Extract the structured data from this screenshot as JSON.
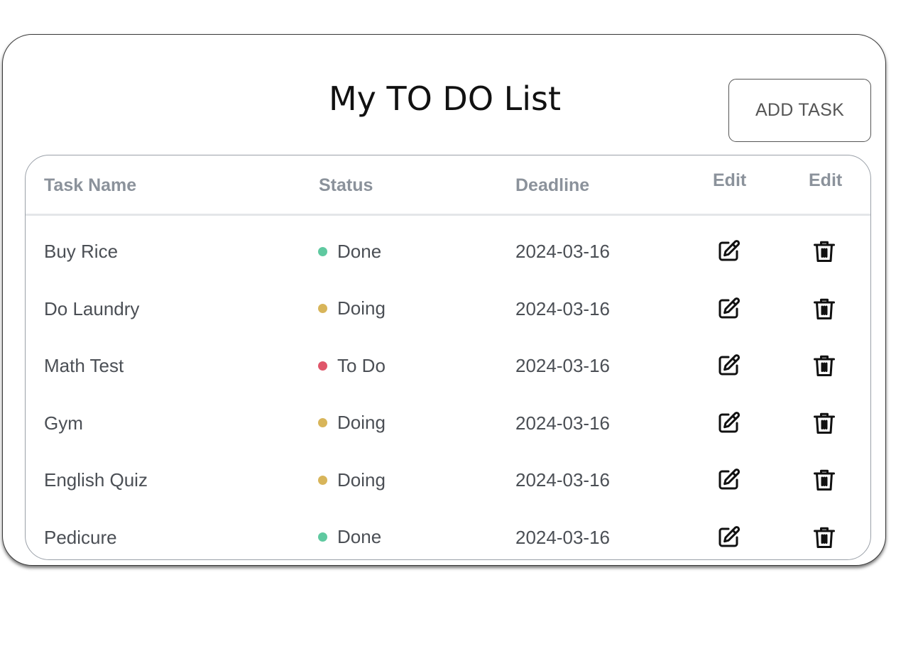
{
  "page": {
    "title": "My TO DO List",
    "add_button_label": "ADD TASK"
  },
  "table": {
    "headers": {
      "task_name": "Task Name",
      "status": "Status",
      "deadline": "Deadline",
      "edit": "Edit",
      "delete": "Edit"
    },
    "rows": [
      {
        "task": "Buy Rice",
        "status": "Done",
        "status_color": "#5fc9a0",
        "deadline": "2024-03-16"
      },
      {
        "task": "Do Laundry",
        "status": "Doing",
        "status_color": "#d8b55a",
        "deadline": "2024-03-16"
      },
      {
        "task": "Math Test",
        "status": "To Do",
        "status_color": "#e0566a",
        "deadline": "2024-03-16"
      },
      {
        "task": "Gym",
        "status": "Doing",
        "status_color": "#d8b55a",
        "deadline": "2024-03-16"
      },
      {
        "task": "English Quiz",
        "status": "Doing",
        "status_color": "#d8b55a",
        "deadline": "2024-03-16"
      },
      {
        "task": "Pedicure",
        "status": "Done",
        "status_color": "#5fc9a0",
        "deadline": "2024-03-16"
      }
    ],
    "row_icons": {
      "edit": "edit-icon",
      "delete": "trash-icon"
    }
  }
}
